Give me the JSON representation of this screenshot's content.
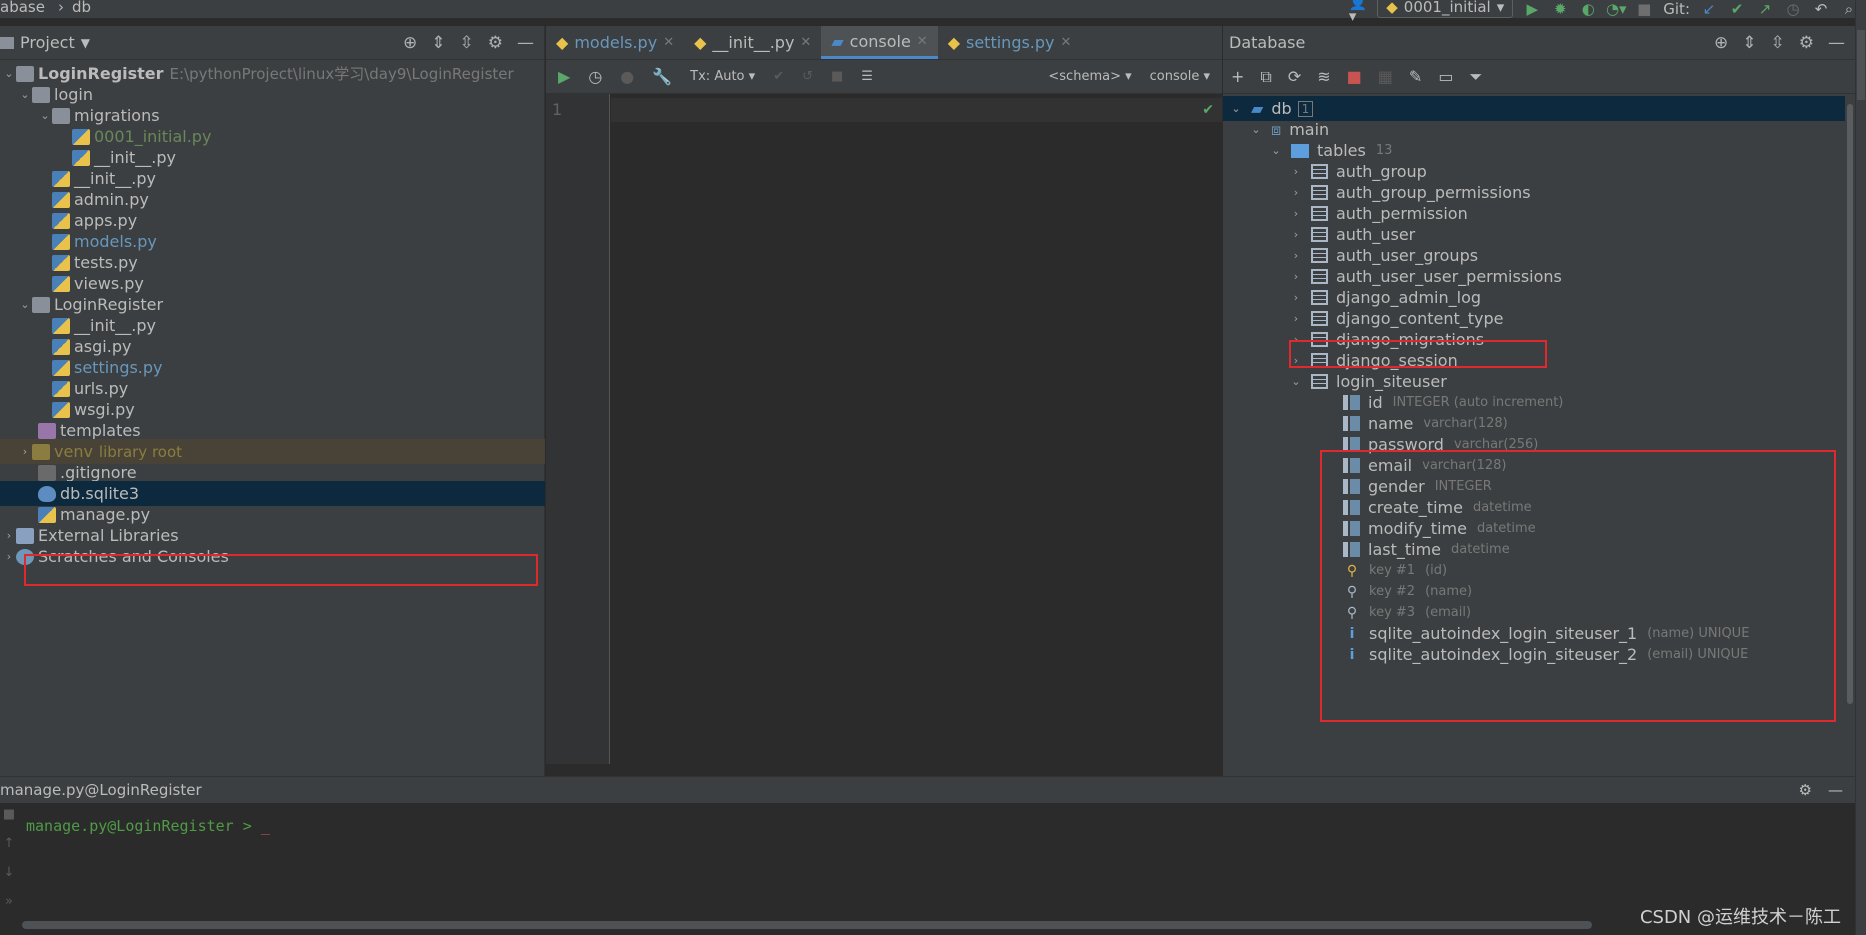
{
  "topbar": {
    "crumb_db": "abase",
    "crumb_file": "db",
    "run_config": "0001_initial",
    "git_label": "Git:"
  },
  "project": {
    "title": "Project",
    "rows": [
      {
        "label": "LoginRegister",
        "path": "E:\\pythonProject\\linux学习\\day9\\LoginRegister"
      },
      {
        "label": "login"
      },
      {
        "label": "migrations"
      },
      {
        "label": "0001_initial.py"
      },
      {
        "label": "__init__.py"
      },
      {
        "label": "__init__.py"
      },
      {
        "label": "admin.py"
      },
      {
        "label": "apps.py"
      },
      {
        "label": "models.py"
      },
      {
        "label": "tests.py"
      },
      {
        "label": "views.py"
      },
      {
        "label": "LoginRegister"
      },
      {
        "label": "__init__.py"
      },
      {
        "label": "asgi.py"
      },
      {
        "label": "settings.py"
      },
      {
        "label": "urls.py"
      },
      {
        "label": "wsgi.py"
      },
      {
        "label": "templates"
      },
      {
        "label": "venv",
        "note": "library root"
      },
      {
        "label": ".gitignore"
      },
      {
        "label": "db.sqlite3"
      },
      {
        "label": "manage.py"
      },
      {
        "label": "External Libraries"
      },
      {
        "label": "Scratches and Consoles"
      }
    ]
  },
  "editor": {
    "tabs": [
      "models.py",
      "__init__.py",
      "console",
      "settings.py"
    ],
    "tx_label": "Tx: Auto",
    "schema_label": "<schema>",
    "console_label": "console",
    "line_number": "1"
  },
  "database": {
    "title": "Database",
    "root": "db",
    "root_badge": "1",
    "schema": "main",
    "tables_label": "tables",
    "tables_count": "13",
    "tables": [
      "auth_group",
      "auth_group_permissions",
      "auth_permission",
      "auth_user",
      "auth_user_groups",
      "auth_user_user_permissions",
      "django_admin_log",
      "django_content_type",
      "django_migrations",
      "django_session",
      "login_siteuser"
    ],
    "columns": [
      {
        "name": "id",
        "type": "INTEGER (auto increment)"
      },
      {
        "name": "name",
        "type": "varchar(128)"
      },
      {
        "name": "password",
        "type": "varchar(256)"
      },
      {
        "name": "email",
        "type": "varchar(128)"
      },
      {
        "name": "gender",
        "type": "INTEGER"
      },
      {
        "name": "create_time",
        "type": "datetime"
      },
      {
        "name": "modify_time",
        "type": "datetime"
      },
      {
        "name": "last_time",
        "type": "datetime"
      }
    ],
    "keys": [
      {
        "name": "key #1",
        "cols": "(id)"
      },
      {
        "name": "key #2",
        "cols": "(name)"
      },
      {
        "name": "key #3",
        "cols": "(email)"
      }
    ],
    "indexes": [
      {
        "name": "sqlite_autoindex_login_siteuser_1",
        "desc": "(name) UNIQUE"
      },
      {
        "name": "sqlite_autoindex_login_siteuser_2",
        "desc": "(email) UNIQUE"
      }
    ]
  },
  "terminal": {
    "title": "manage.py@LoginRegister",
    "prompt": "manage.py@LoginRegister > "
  },
  "watermark": "CSDN @运维技术－陈工",
  "colors": {
    "highlight": "#e0282f",
    "selection": "#0d293e",
    "accent": "#4a88c7"
  }
}
